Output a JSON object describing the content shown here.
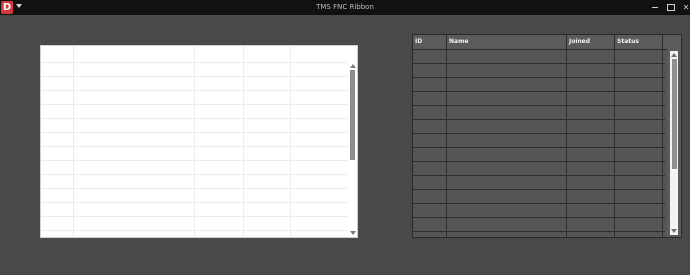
{
  "titlebar": {
    "app_icon_letter": "D",
    "title": "TMS FNC Ribbon",
    "minimize_glyph": "",
    "maximize_glyph": "",
    "close_glyph": "✕"
  },
  "right_grid": {
    "columns": [
      {
        "label": "ID"
      },
      {
        "label": "Name"
      },
      {
        "label": "Joined"
      },
      {
        "label": "Status"
      }
    ]
  },
  "colors": {
    "background": "#494949",
    "titlebar": "#111111",
    "app_icon": "#d6383f",
    "dark_grid": "#555555",
    "light_grid": "#ffffff"
  },
  "icons": {
    "app": "app-logo-icon",
    "quick_access": "chevron-down-icon",
    "minimize": "minimize-icon",
    "maximize": "maximize-icon",
    "close": "close-icon"
  }
}
